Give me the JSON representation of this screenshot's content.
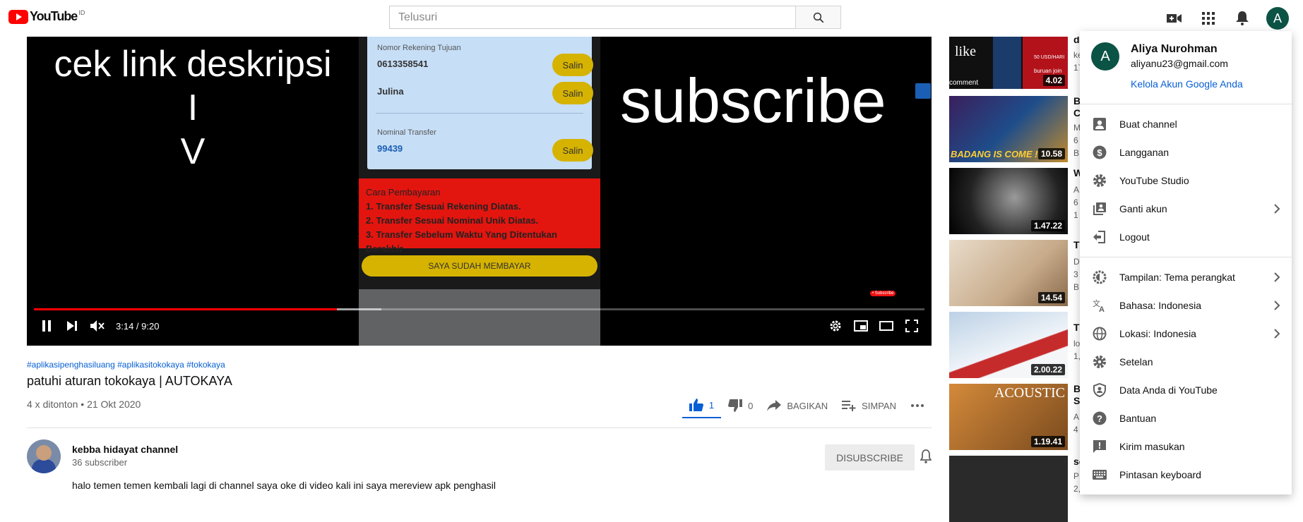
{
  "topbar": {
    "logo_text": "YouTube",
    "country_code": "ID",
    "search_placeholder": "Telusuri",
    "avatar_letter": "A"
  },
  "player": {
    "overlay_left": [
      "cek link deskripsi",
      "I",
      "V"
    ],
    "overlay_right": "subscribe",
    "phone": {
      "label_account": "Nomor Rekening Tujuan",
      "account_number": "0613358541",
      "account_name": "Julina",
      "label_amount": "Nominal Transfer",
      "amount": "99439",
      "copy_label": "Salin",
      "payment_title": "Cara Pembayaran",
      "payment_steps": [
        "1. Transfer Sesuai Rekening Diatas.",
        "2. Transfer Sesuai Nominal Unik Diatas.",
        "3. Transfer Sebelum Waktu Yang Ditentukan Berakhir"
      ],
      "paid_button": "SAYA SUDAH MEMBAYAR"
    },
    "subscribe_tag": "• Subscribe",
    "time": "3:14 / 9:20",
    "progress_fraction": 0.34
  },
  "video": {
    "hashtags": "#aplikasipenghasiluang #aplikasitokokaya #tokokaya",
    "title": "patuhi aturan tokokaya | AUTOKAYA",
    "views": "4 x ditonton • 21 Okt 2020",
    "likes": "1",
    "dislikes": "0",
    "share_label": "BAGIKAN",
    "save_label": "SIMPAN",
    "channel_name": "kebba hidayat channel",
    "channel_subs": "36 subscriber",
    "unsubscribe_label": "DISUBSCRIBE",
    "description": "halo temen temen kembali lagi di channel saya oke di video kali ini saya mereview apk penghasil"
  },
  "sidebar": {
    "recommendations": [
      {
        "title": "d",
        "meta": [
          "ke",
          "17"
        ],
        "duration": "4.02",
        "thumb_text": "like",
        "thumb_sub": "comment",
        "thumb_extra": "50 USD/HARI",
        "thumb_extra2": "buruan join"
      },
      {
        "title": "B",
        "meta": [
          "C",
          "M",
          "6",
          "B"
        ],
        "duration": "10.58",
        "thumb_text": "BADANG IS COME !"
      },
      {
        "title": "W",
        "meta": [
          "A",
          "6",
          "1"
        ],
        "duration": "1.47.22"
      },
      {
        "title": "T",
        "meta": [
          "D",
          "3",
          "B"
        ],
        "duration": "14.54"
      },
      {
        "title": "T",
        "meta": [
          "lo",
          "1,"
        ],
        "duration": "2.00.22"
      },
      {
        "title": "B",
        "meta": [
          "S",
          "A",
          "4"
        ],
        "duration": "1.19.41",
        "thumb_text": "ACOUSTIC"
      },
      {
        "title": "se",
        "meta": [
          "P",
          "2,"
        ],
        "duration": ""
      }
    ]
  },
  "account_menu": {
    "name": "Aliya Nurohman",
    "email": "aliyanu23@gmail.com",
    "manage": "Kelola Akun Google Anda",
    "avatar_letter": "A",
    "groups": [
      [
        {
          "label": "Buat channel",
          "icon": "create-channel-icon",
          "chevron": false
        },
        {
          "label": "Langganan",
          "icon": "dollar-icon",
          "chevron": false
        },
        {
          "label": "YouTube Studio",
          "icon": "gear-icon",
          "chevron": false
        },
        {
          "label": "Ganti akun",
          "icon": "switch-account-icon",
          "chevron": true
        },
        {
          "label": "Logout",
          "icon": "logout-icon",
          "chevron": false
        }
      ],
      [
        {
          "label": "Tampilan: Tema perangkat",
          "icon": "theme-icon",
          "chevron": true
        },
        {
          "label": "Bahasa: Indonesia",
          "icon": "translate-icon",
          "chevron": true
        },
        {
          "label": "Lokasi: Indonesia",
          "icon": "globe-icon",
          "chevron": true
        },
        {
          "label": "Setelan",
          "icon": "gear-icon",
          "chevron": false
        },
        {
          "label": "Data Anda di YouTube",
          "icon": "shield-person-icon",
          "chevron": false
        },
        {
          "label": "Bantuan",
          "icon": "help-icon",
          "chevron": false
        },
        {
          "label": "Kirim masukan",
          "icon": "feedback-icon",
          "chevron": false
        },
        {
          "label": "Pintasan keyboard",
          "icon": "keyboard-icon",
          "chevron": false
        }
      ]
    ]
  },
  "colors": {
    "brand_red": "#ff0000",
    "link_blue": "#065fd4",
    "avatar_green": "#0b5345"
  }
}
